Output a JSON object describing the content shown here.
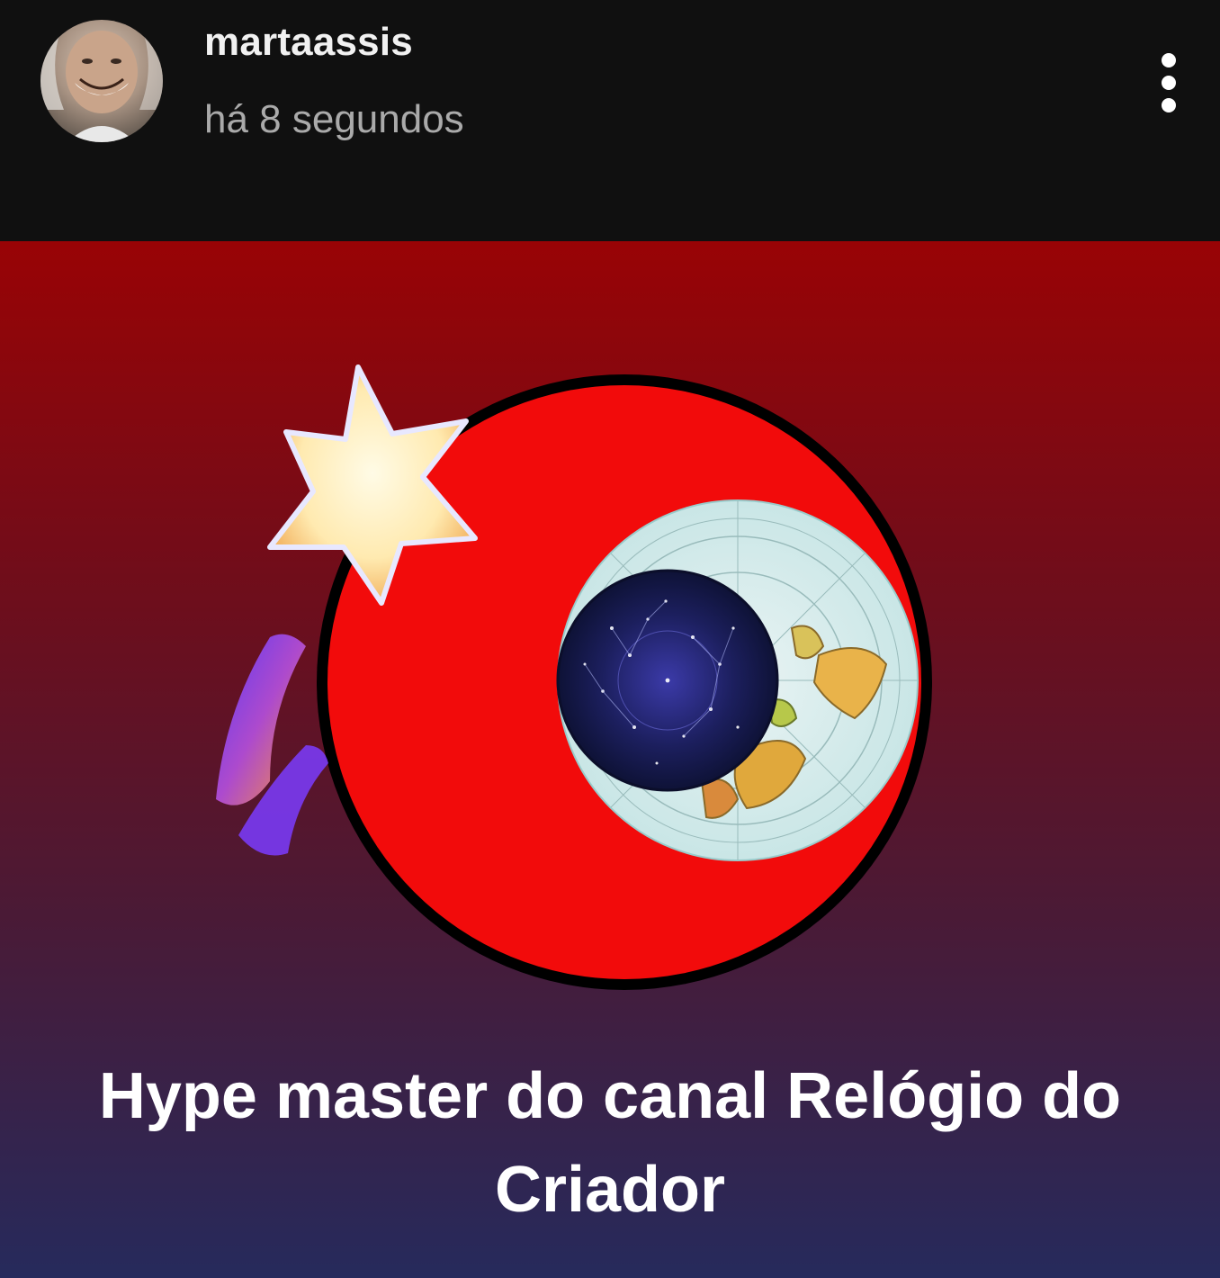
{
  "post_header": {
    "username": "martaassis",
    "timestamp": "há 8 segundos",
    "more_icon": "vertical-ellipsis"
  },
  "post": {
    "caption": "Hype master do canal Relógio do Criador",
    "badge_icon": "shooting-star",
    "logo_icon": "flat-earth-clock-logo"
  }
}
